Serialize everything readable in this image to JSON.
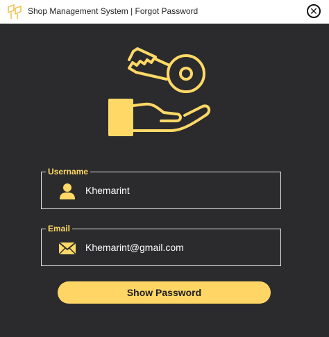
{
  "window": {
    "title": "Shop Management System | Forgot Password",
    "close_glyph": "✕",
    "app_icon": "app-logo-icon"
  },
  "illustration": {
    "icons": [
      "key-icon",
      "hand-icon"
    ],
    "accent": "#ffd966"
  },
  "form": {
    "username": {
      "legend": "Username",
      "value": "Khemarint",
      "icon": "user-icon"
    },
    "email": {
      "legend": "Email",
      "value": "Khemarint@gmail.com",
      "icon": "envelope-icon"
    },
    "submit_label": "Show Password"
  },
  "colors": {
    "background": "#2b2b2d",
    "accent": "#ffd966",
    "button": "#ffd666",
    "titlebar": "#ffffff"
  }
}
